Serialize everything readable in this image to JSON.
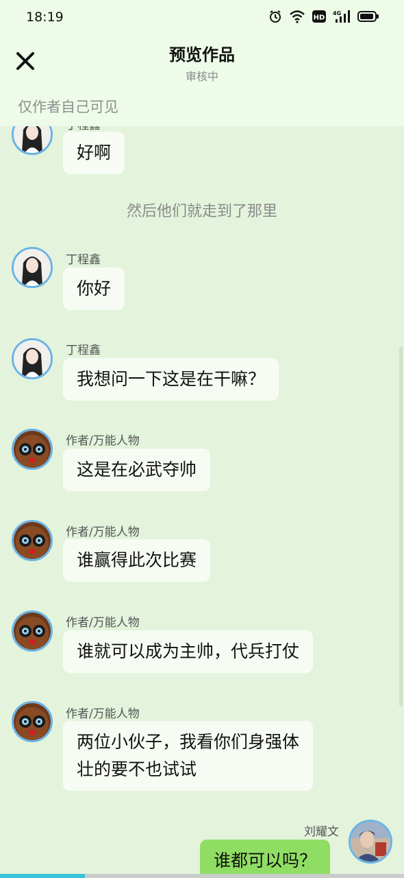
{
  "status_bar": {
    "time": "18:19",
    "icons": [
      "alarm-icon",
      "wifi-icon",
      "hd-icon",
      "4g-signal-icon",
      "battery-icon"
    ],
    "network_label": "4G",
    "hd_label": "HD"
  },
  "header": {
    "title": "预览作品",
    "subtitle": "审核中",
    "close_icon": "close-icon",
    "visibility_note": "仅作者自己可见"
  },
  "chat": {
    "narration": "然后他们就走到了那里",
    "messages": [
      {
        "sender": "丁程鑫",
        "text": "好啊",
        "avatar": "girl-avatar",
        "side": "left"
      },
      {
        "sender": "丁程鑫",
        "text": "你好",
        "avatar": "girl-avatar",
        "side": "left"
      },
      {
        "sender": "丁程鑫",
        "text": "我想问一下这是在干嘛？",
        "avatar": "girl-avatar",
        "side": "left"
      },
      {
        "sender": "作者/万能人物",
        "text": "这是在必武夺帅",
        "avatar": "cartoon-avatar",
        "side": "left"
      },
      {
        "sender": "作者/万能人物",
        "text": "谁赢得此次比赛",
        "avatar": "cartoon-avatar",
        "side": "left"
      },
      {
        "sender": "作者/万能人物",
        "text": "谁就可以成为主帅，代兵打仗",
        "avatar": "cartoon-avatar",
        "side": "left"
      },
      {
        "sender": "作者/万能人物",
        "text_line1": "两位小伙子，我看你们身强体",
        "text_line2": "壮的要不也试试",
        "avatar": "cartoon-avatar",
        "side": "left"
      },
      {
        "sender": "刘耀文",
        "text": "谁都可以吗？",
        "avatar": "boy-avatar",
        "side": "right"
      }
    ]
  },
  "colors": {
    "background": "#e3f3dc",
    "header_bg": "#eefbe8",
    "bubble_left": "#f6fcf3",
    "bubble_right": "#8fde63",
    "avatar_ring": "#6ab3e6",
    "progress": "#38c3d6"
  },
  "reading_progress_percent": 21
}
